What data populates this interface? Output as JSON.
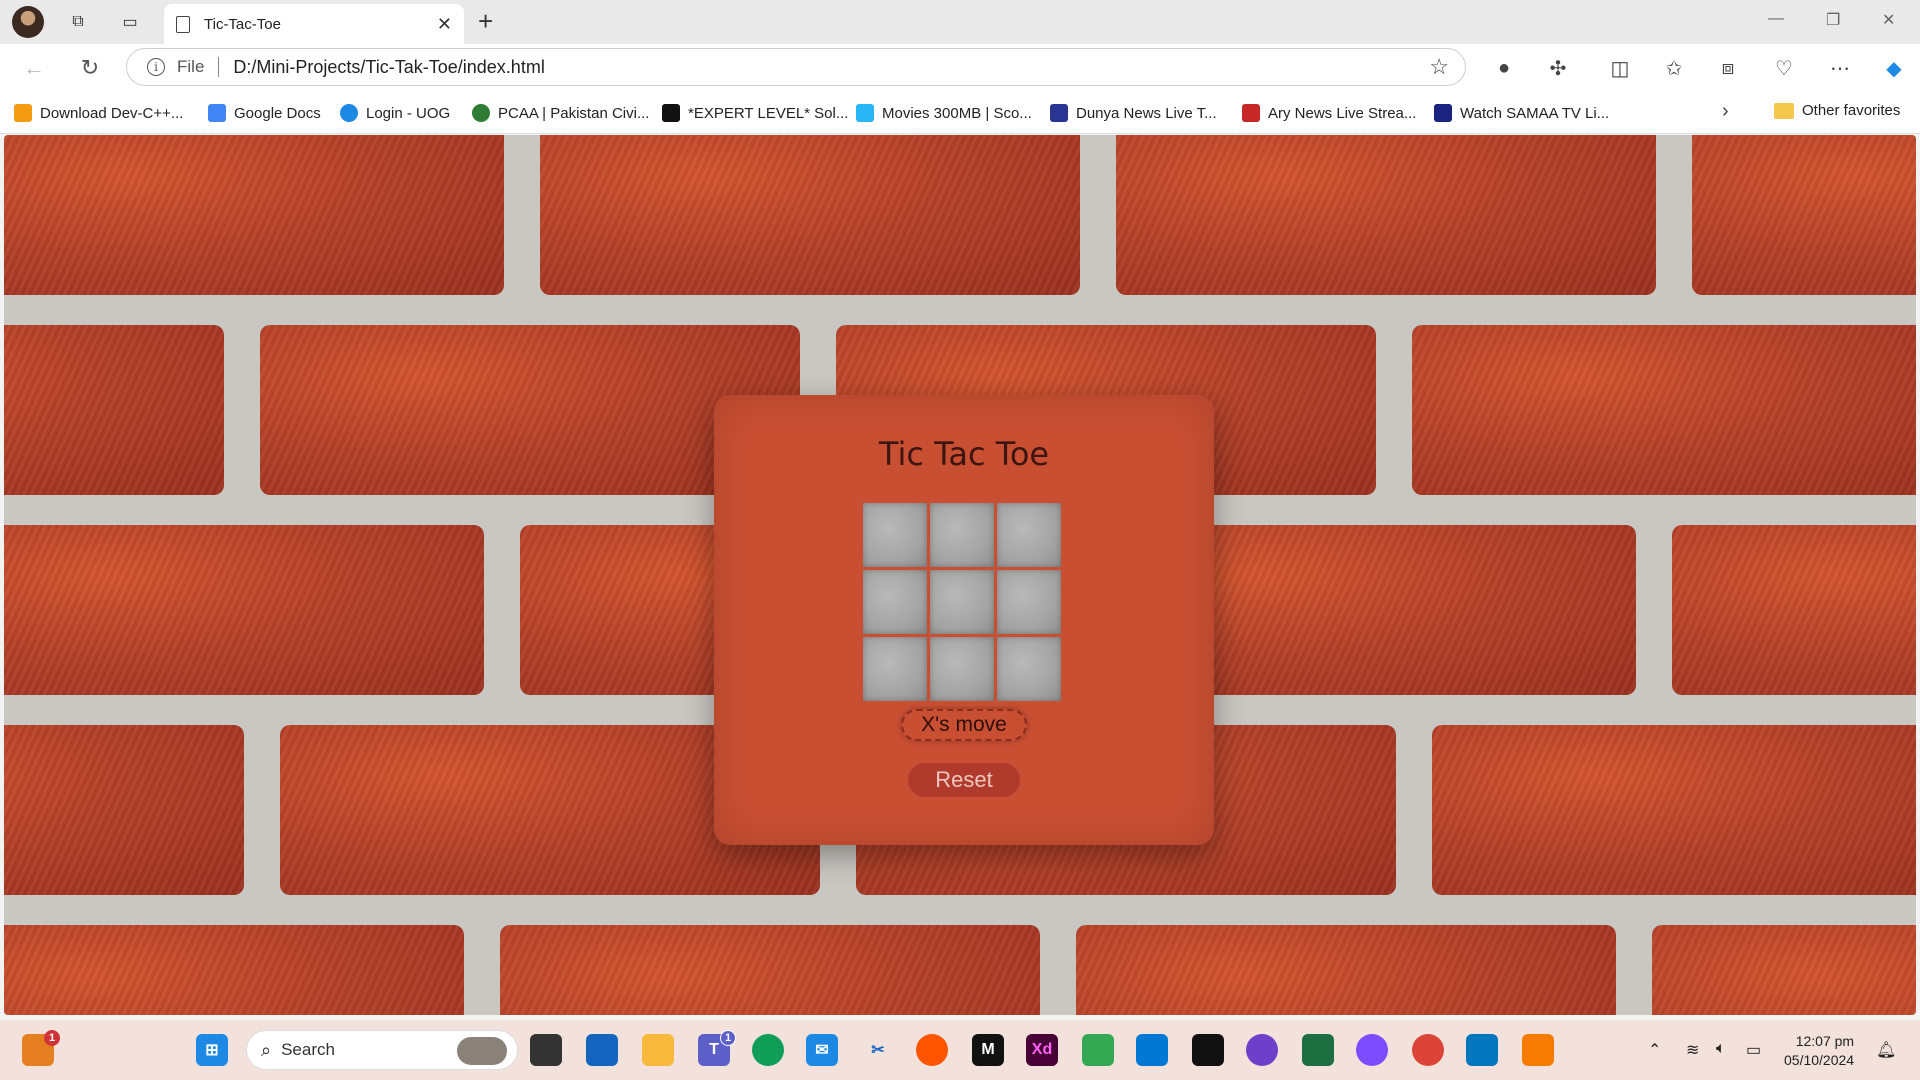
{
  "browser": {
    "tab_title": "Tic-Tac-Toe",
    "tab_close": "✕",
    "new_tab": "+",
    "file_label": "File",
    "url": "D:/Mini-Projects/Tic-Tak-Toe/index.html"
  },
  "favorites": [
    {
      "label": "Download Dev-C++...",
      "color": "#f39c12"
    },
    {
      "label": "Google Docs",
      "color": "#4285f4"
    },
    {
      "label": "Login - UOG",
      "color": "#1e88e5"
    },
    {
      "label": "PCAA | Pakistan Civi...",
      "color": "#2e7d32"
    },
    {
      "label": "*EXPERT LEVEL* Sol...",
      "color": "#111111"
    },
    {
      "label": "Movies 300MB | Sco...",
      "color": "#29b6f6"
    },
    {
      "label": "Dunya News Live T...",
      "color": "#283593"
    },
    {
      "label": "Ary News Live Strea...",
      "color": "#c62828"
    },
    {
      "label": "Watch SAMAA TV Li...",
      "color": "#1a237e"
    }
  ],
  "other_favorites": "Other favorites",
  "game": {
    "title": "Tic Tac Toe",
    "cells": [
      "",
      "",
      "",
      "",
      "",
      "",
      "",
      "",
      ""
    ],
    "status": "X's move",
    "reset_label": "Reset"
  },
  "taskbar": {
    "search_label": "Search",
    "time": "12:07 pm",
    "date": "05/10/2024",
    "widget_badge": "1",
    "teams_badge": "1",
    "xd_label": "Xd",
    "m_label": "M"
  },
  "colors": {
    "card": "#c94f33",
    "brick": "#b6422a",
    "mortar": "#c9c7c1",
    "cell": "#a4a4a4"
  }
}
